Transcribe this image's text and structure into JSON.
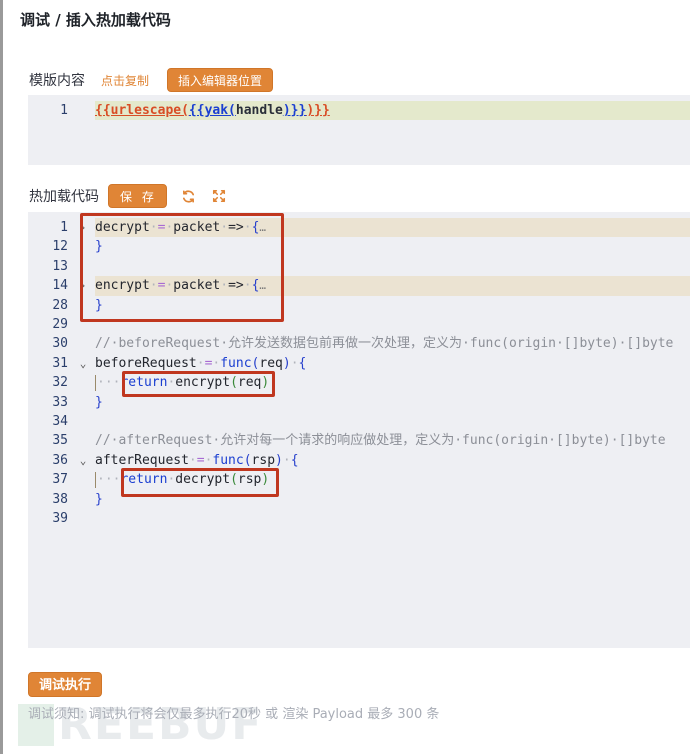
{
  "modal": {
    "title": "调试 / 插入热加载代码"
  },
  "template_section": {
    "label": "模版内容",
    "copy_link": "点击复制",
    "insert_button": "插入编辑器位置",
    "editor": {
      "lines": [
        {
          "number": "1",
          "parts": [
            {
              "t": "{{urlescape(",
              "c": "tpl-red"
            },
            {
              "t": "{{yak(",
              "c": "tpl-blue"
            },
            {
              "t": "handle",
              "c": "tpl-dark"
            },
            {
              "t": ")}}",
              "c": "tpl-blue"
            },
            {
              "t": ")}}",
              "c": "tpl-red"
            }
          ]
        }
      ]
    }
  },
  "hotload_section": {
    "label": "热加载代码",
    "save_button": "保 存",
    "icons": [
      "refresh-icon",
      "fullscreen-icon"
    ],
    "editor": {
      "lines": [
        {
          "number": "1",
          "fold": "›",
          "highlight": "fold",
          "parts": [
            {
              "t": "decrypt",
              "c": ""
            },
            {
              "t": "·",
              "c": "ws"
            },
            {
              "t": "=",
              "c": "op"
            },
            {
              "t": "·",
              "c": "ws"
            },
            {
              "t": "packet",
              "c": ""
            },
            {
              "t": "·",
              "c": "ws"
            },
            {
              "t": "=>",
              "c": ""
            },
            {
              "t": "·",
              "c": "ws"
            },
            {
              "t": "{",
              "c": "br"
            },
            {
              "t": "…",
              "c": "ellipsis"
            }
          ]
        },
        {
          "number": "12",
          "parts": [
            {
              "t": "}",
              "c": "br"
            }
          ]
        },
        {
          "number": "13",
          "parts": []
        },
        {
          "number": "14",
          "fold": "›",
          "highlight": "fold",
          "parts": [
            {
              "t": "encrypt",
              "c": ""
            },
            {
              "t": "·",
              "c": "ws"
            },
            {
              "t": "=",
              "c": "op"
            },
            {
              "t": "·",
              "c": "ws"
            },
            {
              "t": "packet",
              "c": ""
            },
            {
              "t": "·",
              "c": "ws"
            },
            {
              "t": "=>",
              "c": ""
            },
            {
              "t": "·",
              "c": "ws"
            },
            {
              "t": "{",
              "c": "br"
            },
            {
              "t": "…",
              "c": "ellipsis"
            }
          ]
        },
        {
          "number": "28",
          "parts": [
            {
              "t": "}",
              "c": "br"
            }
          ]
        },
        {
          "number": "29",
          "parts": []
        },
        {
          "number": "30",
          "parts": [
            {
              "t": "//·beforeRequest·允许发送数据包前再做一次处理，定义为·func(origin·[]byte)·[]byte",
              "c": "cm"
            }
          ]
        },
        {
          "number": "31",
          "fold": "⌄",
          "parts": [
            {
              "t": "beforeRequest",
              "c": ""
            },
            {
              "t": "·",
              "c": "ws"
            },
            {
              "t": "=",
              "c": "op"
            },
            {
              "t": "·",
              "c": "ws"
            },
            {
              "t": "func",
              "c": "kw"
            },
            {
              "t": "(",
              "c": "br"
            },
            {
              "t": "req",
              "c": ""
            },
            {
              "t": ")",
              "c": "br"
            },
            {
              "t": "·",
              "c": "ws"
            },
            {
              "t": "{",
              "c": "br"
            }
          ]
        },
        {
          "number": "32",
          "indent": true,
          "parts": [
            {
              "t": "···",
              "c": "ws"
            },
            {
              "t": "return",
              "c": "kw"
            },
            {
              "t": "·",
              "c": "ws"
            },
            {
              "t": "encrypt",
              "c": ""
            },
            {
              "t": "(",
              "c": "paren"
            },
            {
              "t": "req",
              "c": ""
            },
            {
              "t": ")",
              "c": "paren"
            }
          ]
        },
        {
          "number": "33",
          "parts": [
            {
              "t": "}",
              "c": "br"
            }
          ]
        },
        {
          "number": "34",
          "parts": []
        },
        {
          "number": "35",
          "parts": [
            {
              "t": "//·afterRequest·允许对每一个请求的响应做处理，定义为·func(origin·[]byte)·[]byte",
              "c": "cm"
            }
          ]
        },
        {
          "number": "36",
          "fold": "⌄",
          "parts": [
            {
              "t": "afterRequest",
              "c": ""
            },
            {
              "t": "·",
              "c": "ws"
            },
            {
              "t": "=",
              "c": "op"
            },
            {
              "t": "·",
              "c": "ws"
            },
            {
              "t": "func",
              "c": "kw"
            },
            {
              "t": "(",
              "c": "br"
            },
            {
              "t": "rsp",
              "c": ""
            },
            {
              "t": ")",
              "c": "br"
            },
            {
              "t": "·",
              "c": "ws"
            },
            {
              "t": "{",
              "c": "br"
            }
          ]
        },
        {
          "number": "37",
          "indent": true,
          "parts": [
            {
              "t": "···",
              "c": "ws"
            },
            {
              "t": "return",
              "c": "kw"
            },
            {
              "t": "·",
              "c": "ws"
            },
            {
              "t": "decrypt",
              "c": ""
            },
            {
              "t": "(",
              "c": "paren"
            },
            {
              "t": "rsp",
              "c": ""
            },
            {
              "t": ")",
              "c": "paren"
            }
          ]
        },
        {
          "number": "38",
          "parts": [
            {
              "t": "}",
              "c": "br"
            }
          ]
        },
        {
          "number": "39",
          "highlight": "active",
          "parts": []
        }
      ]
    }
  },
  "footer": {
    "debug_button": "调试执行",
    "notice": "调试须知: 调试执行将会仅最多执行20秒 或 渲染 Payload 最多 300 条"
  },
  "watermark": {
    "text": "REEBUF"
  },
  "colors": {
    "accent": "#e08536",
    "annotation_box": "#c0371f",
    "editor_bg": "#eeeff3",
    "active_line": "#e4e9cc",
    "folded_line": "#ebe3d2"
  }
}
